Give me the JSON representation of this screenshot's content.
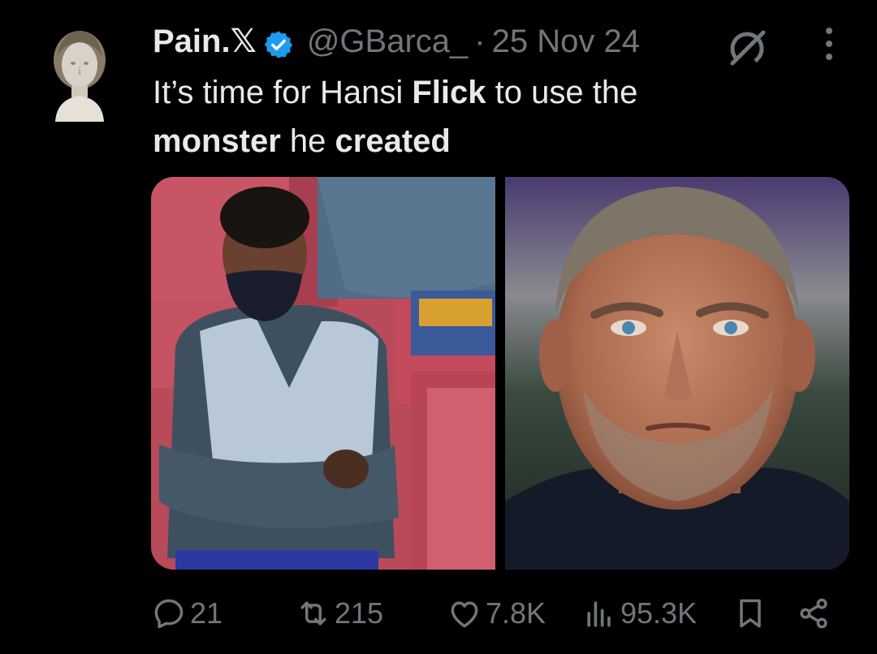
{
  "tweet": {
    "display_name": "Pain.𝕏",
    "handle": "@GBarca_",
    "separator": "·",
    "date": "25 Nov 24",
    "text_segments": [
      {
        "text": "It’s time for Hansi ",
        "bold": false
      },
      {
        "text": "Flick",
        "bold": true
      },
      {
        "text": " to use the ",
        "bold": false
      },
      {
        "text": "monster",
        "bold": true
      },
      {
        "text": " he ",
        "bold": false
      },
      {
        "text": "created",
        "bold": true
      }
    ]
  },
  "actions": {
    "replies": "21",
    "reposts": "215",
    "likes": "7.8K",
    "views": "95.3K"
  },
  "colors": {
    "background": "#000000",
    "text_primary": "#e7e9ea",
    "text_secondary": "#71767b",
    "verified_blue": "#1d9bf0"
  },
  "icons": [
    "verified-badge-icon",
    "grok-icon",
    "more-icon",
    "reply-icon",
    "repost-icon",
    "like-icon",
    "views-icon",
    "bookmark-icon",
    "share-icon"
  ]
}
